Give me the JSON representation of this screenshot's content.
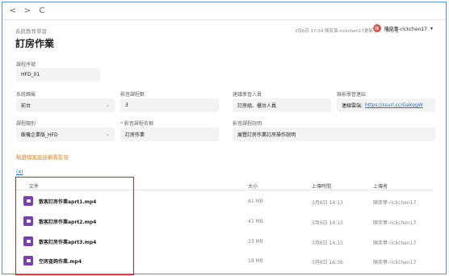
{
  "nav": {
    "back": "<",
    "forward": ">",
    "refresh": "C"
  },
  "breadcrumb": "系統教育學習",
  "page_title": "訂房作業",
  "meta": {
    "updated": "3月6日 17:24 陳奕葦-rickchen17更新了",
    "owner_label": "擁有者",
    "owner_name": "陳奕葦-rickchen17",
    "owner_avatar": "陳"
  },
  "form": {
    "course_code_label": "課程序號",
    "course_code": "HFD_01",
    "system_label": "系統歸屬",
    "system": "前台",
    "hours_label": "影音課程數",
    "hours": "3",
    "audience_label": "建議學習人員",
    "audience": "訂房組、櫃台人員",
    "link_label": "錄影學習連結",
    "link_prefix": "連線雲端:",
    "link_url": "https://ssurl.cc/GakqgW",
    "category_label": "課程類別",
    "category": "飯機企業版_HFD",
    "name_label": "影音課程名稱",
    "name": "訂房作業",
    "desc_label": "影音課程說明",
    "desc": "展豐訂房作業訂房操作說明"
  },
  "watch_link": "點選檔案直接觀看影音",
  "file_count": "(4)",
  "table": {
    "headers": {
      "file": "文件",
      "size": "大小",
      "date": "上傳時間",
      "user": "上傳者"
    },
    "rows": [
      {
        "name": "散客訂房作業aprt1.mp4",
        "size": "41 MB",
        "date": "3月6日 14:13",
        "user": "陳奕葦-rickchen17"
      },
      {
        "name": "散客訂房作業aprt2.mp4",
        "size": "41 MB",
        "date": "3月6日 14:13",
        "user": "陳奕葦-rickchen17"
      },
      {
        "name": "散客訂房作業aprt3.mp4",
        "size": "33 MB",
        "date": "3月6日 14:13",
        "user": "陳奕葦-rickchen17"
      },
      {
        "name": "空房查詢作業.mp4",
        "size": "18 MB",
        "date": "3月6日 16:36",
        "user": "陳奕葦-rickchen17"
      }
    ]
  },
  "colors": {
    "accent": "#2a6dd3",
    "file_icon": "#7a3fb0",
    "highlight": "#e02020",
    "link_orange": "#e08a2b"
  }
}
